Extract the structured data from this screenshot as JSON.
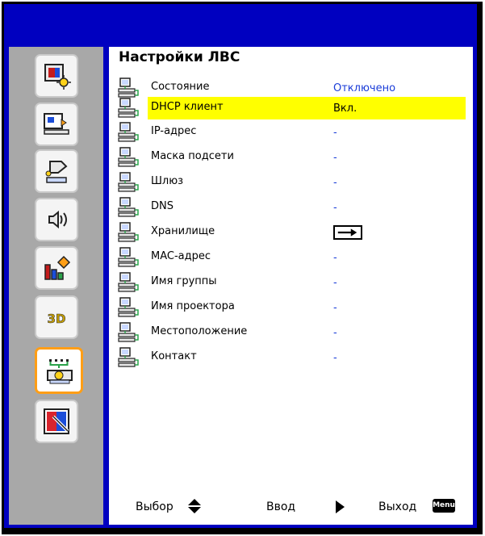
{
  "title": "Настройки ЛВС",
  "rows": [
    {
      "label": "Состояние",
      "value": "Отключено"
    },
    {
      "label": "DHCP клиент",
      "value": "Вкл."
    },
    {
      "label": "IP-адрес",
      "value": "-"
    },
    {
      "label": "Маска подсети",
      "value": "-"
    },
    {
      "label": "Шлюз",
      "value": "-"
    },
    {
      "label": "DNS",
      "value": "-"
    },
    {
      "label": "Хранилище",
      "value": ""
    },
    {
      "label": "MAC-адрес",
      "value": "-"
    },
    {
      "label": "Имя группы",
      "value": "-"
    },
    {
      "label": "Имя проектора",
      "value": "-"
    },
    {
      "label": "Местоположение",
      "value": "-"
    },
    {
      "label": "Контакт",
      "value": "-"
    }
  ],
  "footer": {
    "select": "Выбор",
    "enter": "Ввод",
    "exit": "Выход",
    "menu_badge": "Menu"
  },
  "sidebar_tabs": [
    {
      "name": "image-icon"
    },
    {
      "name": "display-icon"
    },
    {
      "name": "settings-icon"
    },
    {
      "name": "volume-icon"
    },
    {
      "name": "options-icon"
    },
    {
      "name": "3d-icon",
      "label": "3D"
    },
    {
      "name": "lan-icon"
    },
    {
      "name": "interactive-icon"
    }
  ],
  "colors": {
    "frame": "#0000c0",
    "sidebar": "#a8a8a8",
    "highlight": "#ffff00",
    "value_text": "#1a3cd8",
    "active_tab_border": "#ff9e16"
  }
}
